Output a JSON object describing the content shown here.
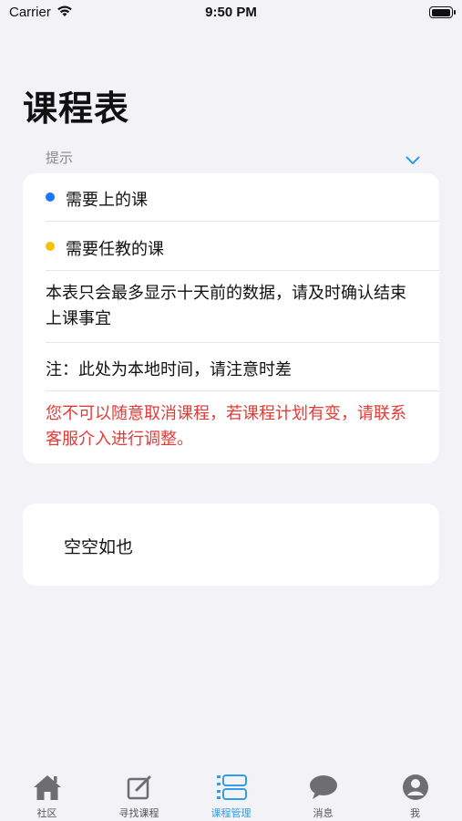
{
  "status_bar": {
    "carrier": "Carrier",
    "time": "9:50 PM"
  },
  "page": {
    "title": "课程表"
  },
  "hint": {
    "label": "提示"
  },
  "notice": {
    "legend": [
      {
        "label": "需要上的课",
        "color": "#1677ff"
      },
      {
        "label": "需要任教的课",
        "color": "#f5c400"
      }
    ],
    "lines": [
      "本表只会最多显示十天前的数据，请及时确认结束上课事宜",
      "注：此处为本地时间，请注意时差"
    ],
    "warning": "您不可以随意取消课程，若课程计划有变，请联系客服介入进行调整。",
    "warning_color": "#e53935"
  },
  "empty": {
    "text": "空空如也"
  },
  "tabbar": {
    "active_color": "#2e9ee6",
    "items": [
      {
        "label": "社区",
        "icon": "house-icon"
      },
      {
        "label": "寻找课程",
        "icon": "edit-icon"
      },
      {
        "label": "课程管理",
        "icon": "schedule-icon",
        "active": true
      },
      {
        "label": "消息",
        "icon": "chat-bubble-icon"
      },
      {
        "label": "我",
        "icon": "person-icon"
      }
    ]
  }
}
